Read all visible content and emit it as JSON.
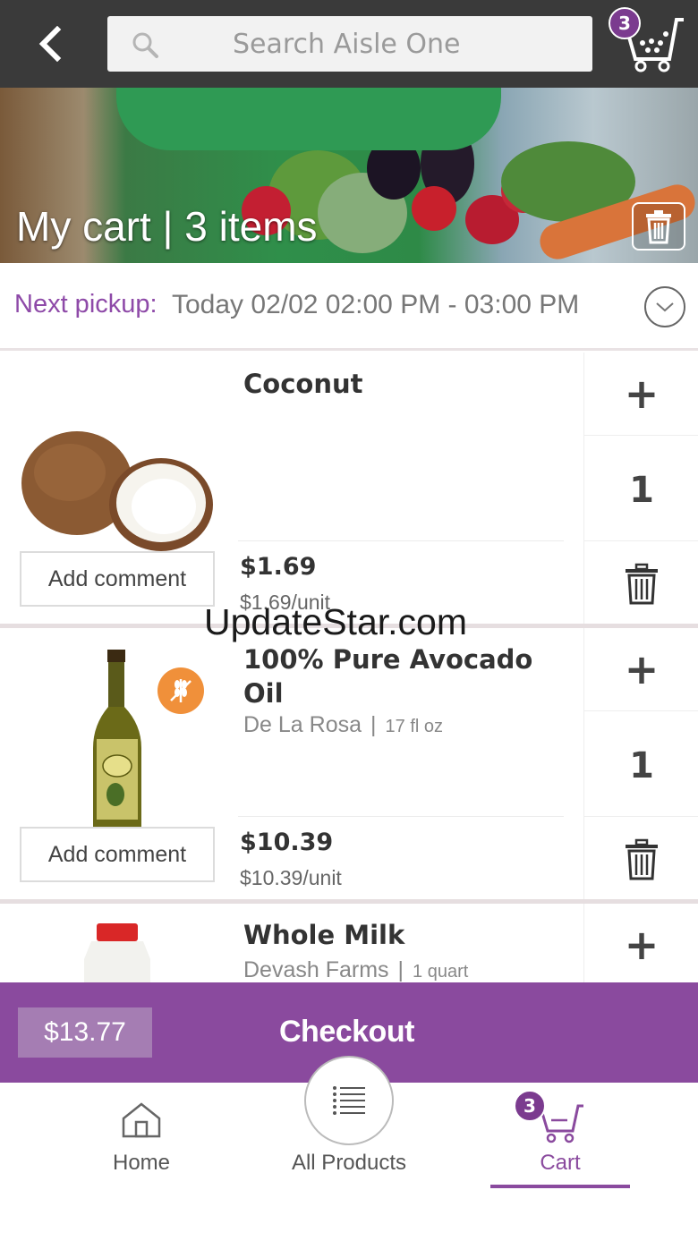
{
  "header": {
    "search_placeholder": "Search Aisle One",
    "cart_count": "3"
  },
  "hero": {
    "title": "My cart | 3 items"
  },
  "pickup": {
    "label": "Next pickup:",
    "value": "Today 02/02 02:00 PM - 03:00 PM"
  },
  "items": [
    {
      "name": "Coconut",
      "price": "$1.69",
      "unit_price": "$1.69/unit",
      "quantity": "1",
      "comment_label": "Add comment"
    },
    {
      "name": "100% Pure Avocado Oil",
      "brand": "De La Rosa",
      "brand_sep": "|",
      "size": "17 fl oz",
      "price": "$10.39",
      "unit_price": "$10.39/unit",
      "quantity": "1",
      "comment_label": "Add comment",
      "badge_icon": "gluten-free-icon"
    },
    {
      "name": "Whole Milk",
      "brand": "Devash Farms",
      "brand_sep": "|",
      "size": "1 quart"
    }
  ],
  "checkout": {
    "total": "$13.77",
    "label": "Checkout"
  },
  "nav": {
    "home": "Home",
    "all_products": "All Products",
    "cart": "Cart",
    "cart_count": "3"
  },
  "watermark": "UpdateStar.com",
  "colors": {
    "accent": "#8a4a9e",
    "topbar": "#3a3a3a",
    "pickup_label": "#8e4aa8",
    "badge_orange": "#f0903a"
  }
}
